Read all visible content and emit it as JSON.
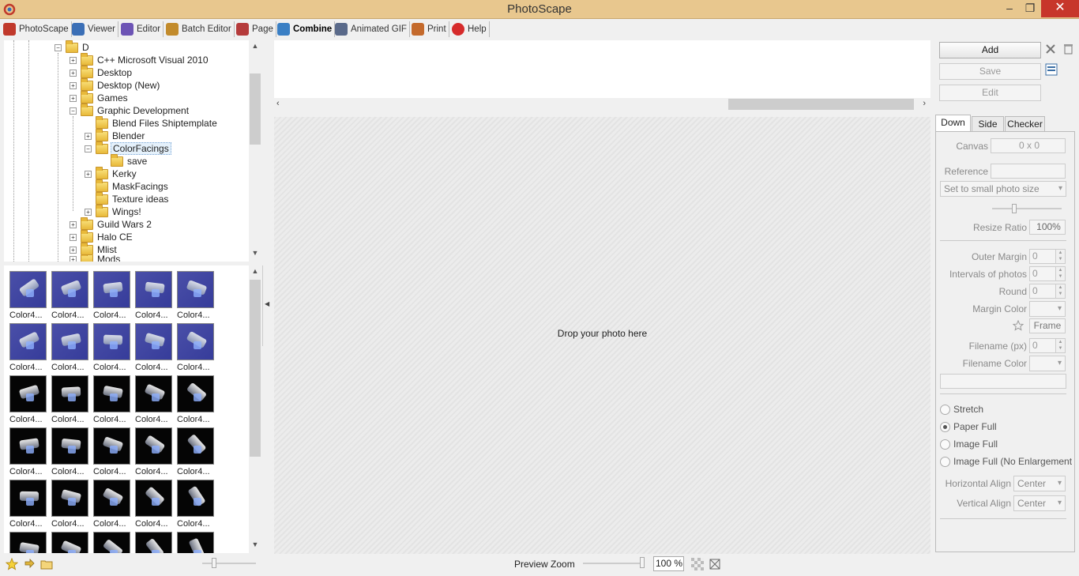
{
  "window": {
    "title": "PhotoScape"
  },
  "menu": [
    {
      "label": "PhotoScape",
      "color": "#c0392b"
    },
    {
      "label": "Viewer",
      "color": "#3b6fb6"
    },
    {
      "label": "Editor",
      "color": "#6d54b5"
    },
    {
      "label": "Batch Editor",
      "color": "#c28b2c"
    },
    {
      "label": "Page",
      "color": "#b53b3b"
    },
    {
      "label": "Combine",
      "color": "#3a7fc4"
    },
    {
      "label": "Animated GIF",
      "color": "#5a6a8a"
    },
    {
      "label": "Print",
      "color": "#c46a2c"
    },
    {
      "label": "Help",
      "color": "#d62b2b"
    }
  ],
  "tree": [
    {
      "label": "D",
      "level": 0,
      "state": "-"
    },
    {
      "label": "C++ Microsoft Visual 2010",
      "level": 1,
      "state": "+"
    },
    {
      "label": "Desktop",
      "level": 1,
      "state": "+"
    },
    {
      "label": "Desktop (New)",
      "level": 1,
      "state": "+"
    },
    {
      "label": "Games",
      "level": 1,
      "state": "+"
    },
    {
      "label": "Graphic Development",
      "level": 1,
      "state": "-"
    },
    {
      "label": "Blend Files Shiptemplate",
      "level": 2,
      "state": ""
    },
    {
      "label": "Blender",
      "level": 2,
      "state": "+"
    },
    {
      "label": "ColorFacings",
      "level": 2,
      "state": "-",
      "selected": true
    },
    {
      "label": "save",
      "level": 3,
      "state": ""
    },
    {
      "label": "Kerky",
      "level": 2,
      "state": "+"
    },
    {
      "label": "MaskFacings",
      "level": 2,
      "state": ""
    },
    {
      "label": "Texture ideas",
      "level": 2,
      "state": ""
    },
    {
      "label": "Wings!",
      "level": 2,
      "state": "+"
    },
    {
      "label": "Guild Wars 2",
      "level": 1,
      "state": "+"
    },
    {
      "label": "Halo CE",
      "level": 1,
      "state": "+"
    },
    {
      "label": "Mlist",
      "level": 1,
      "state": "+"
    },
    {
      "label": "Mods",
      "level": 1,
      "state": "+"
    }
  ],
  "thumbnails": {
    "label": "Color4...",
    "rows": [
      "blue",
      "blue",
      "black",
      "black",
      "black",
      "black"
    ]
  },
  "center": {
    "drop_text": "Drop your photo here"
  },
  "buttons": {
    "add": "Add",
    "save": "Save",
    "edit": "Edit"
  },
  "tabs": [
    "Down",
    "Side",
    "Checker"
  ],
  "panel": {
    "canvas_label": "Canvas",
    "canvas_value": "0 x 0",
    "reference_label": "Reference",
    "size_select": "Set to small photo size",
    "resize_ratio_label": "Resize Ratio",
    "resize_ratio_value": "100%",
    "outer_margin_label": "Outer Margin",
    "outer_margin_value": "0",
    "intervals_label": "Intervals of photos",
    "intervals_value": "0",
    "round_label": "Round",
    "round_value": "0",
    "margin_color_label": "Margin Color",
    "frame_label": "Frame",
    "filename_px_label": "Filename (px)",
    "filename_px_value": "0",
    "filename_color_label": "Filename Color",
    "radios": [
      {
        "label": "Stretch",
        "checked": false
      },
      {
        "label": "Paper Full",
        "checked": true
      },
      {
        "label": "Image Full",
        "checked": false
      },
      {
        "label": "Image Full (No Enlargement",
        "checked": false
      }
    ],
    "h_align_label": "Horizontal Align",
    "h_align_value": "Center",
    "v_align_label": "Vertical Align",
    "v_align_value": "Center"
  },
  "status": {
    "preview_zoom_label": "Preview Zoom",
    "zoom_value": "100 %"
  }
}
